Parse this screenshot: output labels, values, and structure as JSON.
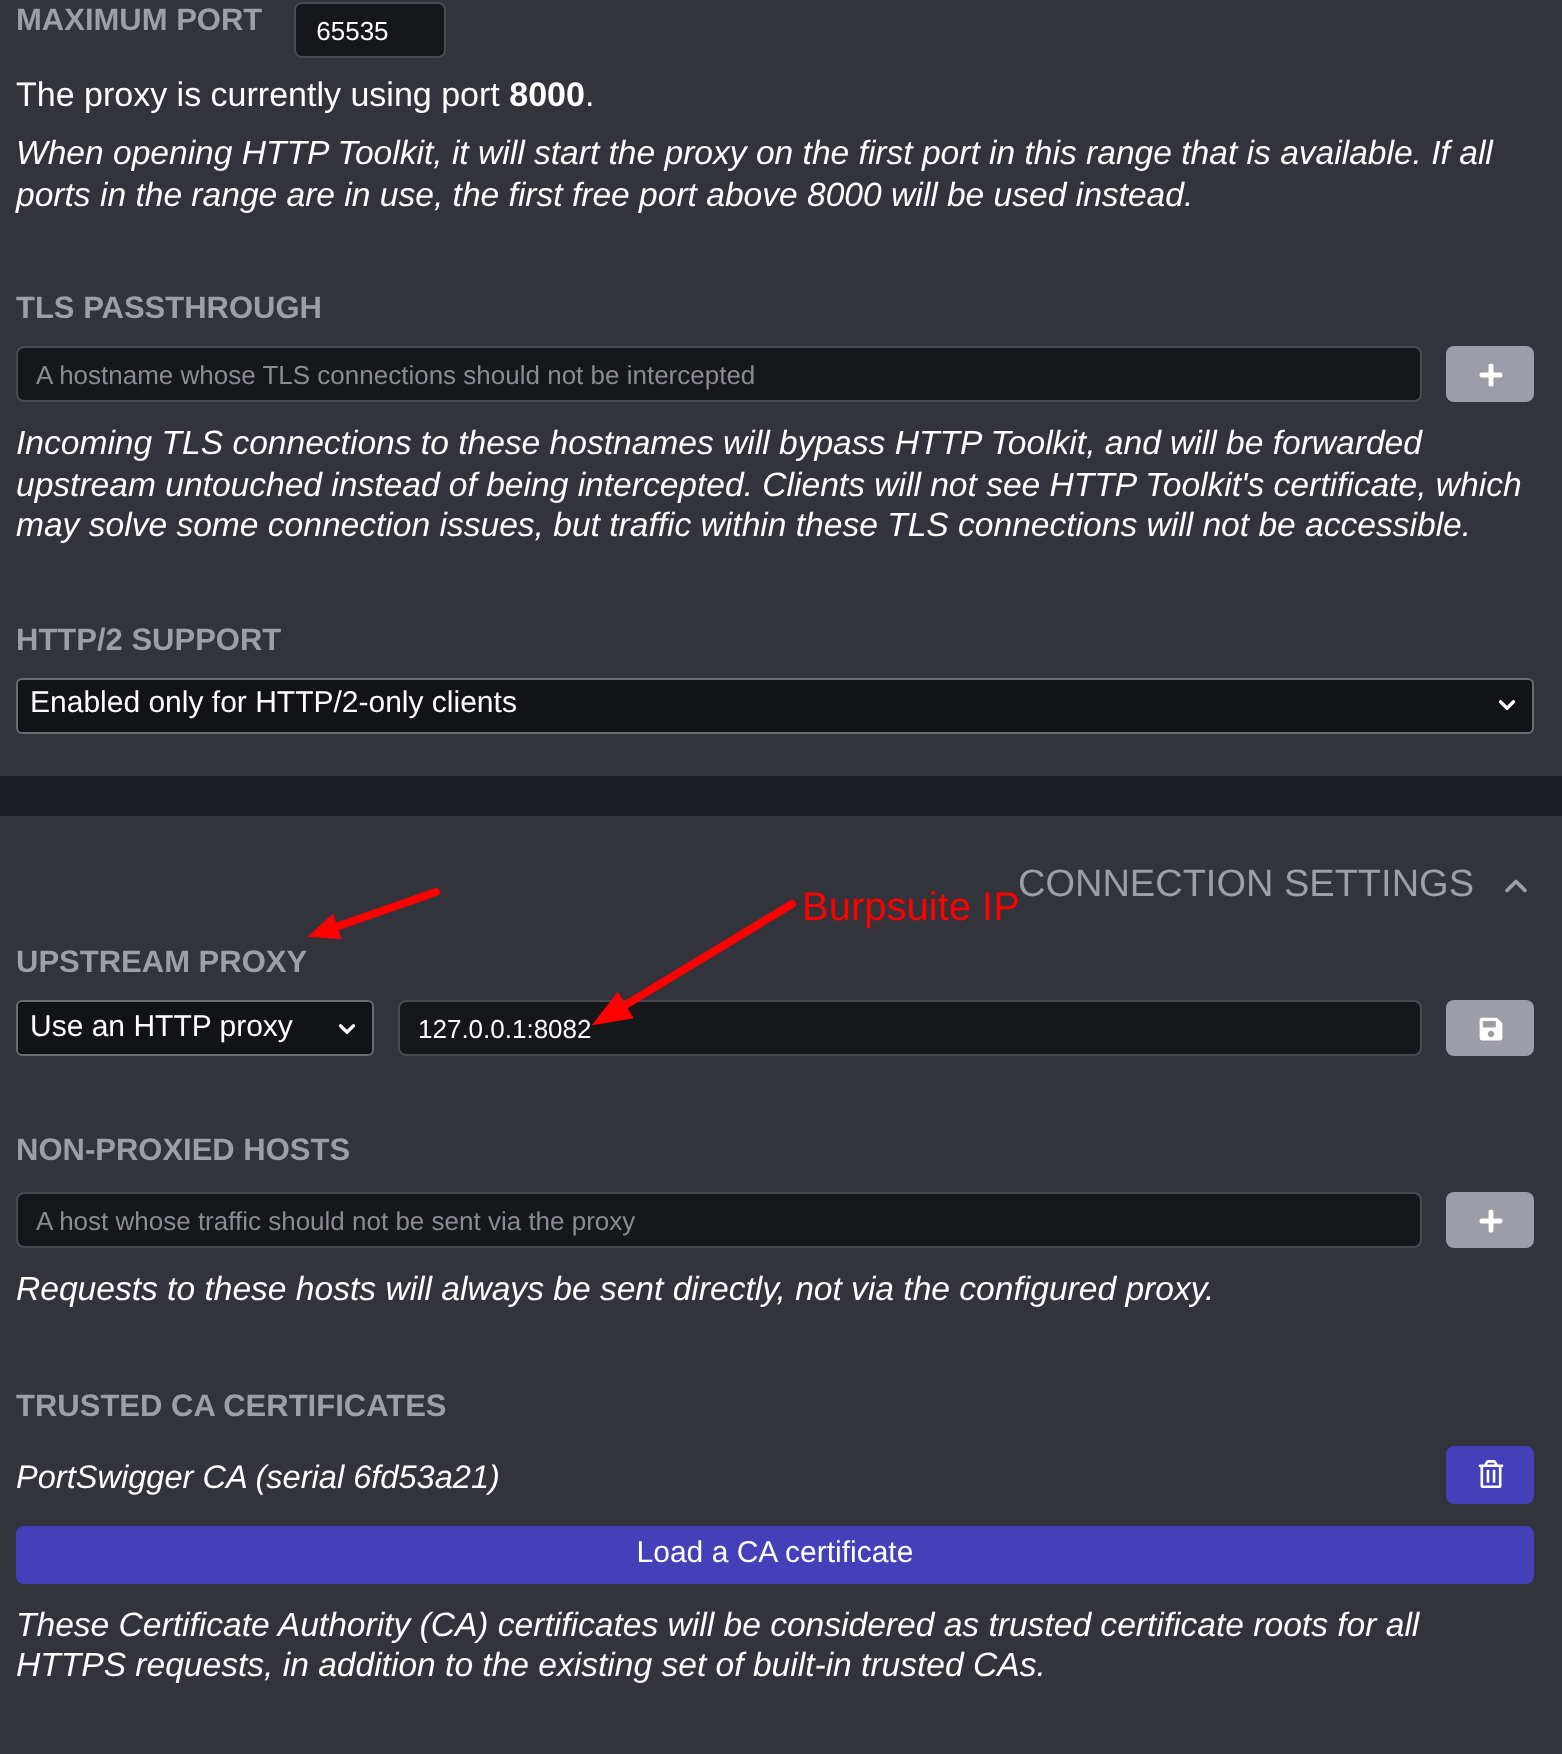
{
  "port_settings": {
    "max_port": {
      "label": "MAXIMUM PORT",
      "value": "65535"
    },
    "status": "The proxy is currently using port **8000**.",
    "note": "When opening HTTP Toolkit, it will start the proxy on the first port in this range that is available. If all ports in the range are in use, the first free port above 8000 will be used instead."
  },
  "tls_passthrough": {
    "label": "TLS PASSTHROUGH",
    "input": {
      "placeholder": "A hostname whose TLS connections should not be intercepted"
    },
    "note": "Incoming TLS connections to these hostnames will bypass HTTP Toolkit, and will be forwarded upstream untouched instead of being intercepted. Clients will not see HTTP Toolkit's certificate, which may solve some connection issues, but traffic within these TLS connections will not be accessible."
  },
  "http2_support": {
    "label": "HTTP/2 SUPPORT",
    "select": {
      "value": "Enabled only for HTTP/2-only clients"
    }
  },
  "connection_settings": {
    "title": "CONNECTION SETTINGS",
    "expanded": true,
    "upstream_proxy": {
      "label": "UPSTREAM PROXY",
      "mode": {
        "value": "Use an HTTP proxy"
      },
      "address": {
        "value": "127.0.0.1:8082"
      }
    },
    "non_proxied_hosts": {
      "label": "NON-PROXIED HOSTS",
      "input": {
        "placeholder": "A host whose traffic should not be sent via the proxy"
      },
      "note": "Requests to these hosts will always be sent directly, not via the configured proxy."
    },
    "trusted_ca_certificates": {
      "label": "TRUSTED CA CERTIFICATES",
      "certificates": [
        {
          "name": "PortSwigger CA (serial 6fd53a21)"
        }
      ],
      "load_button": "Load a CA certificate",
      "note": "These Certificate Authority (CA) certificates will be considered as trusted certificate roots for all HTTPS requests, in addition to the existing set of built-in trusted CAs."
    }
  },
  "annotation": {
    "text": "Burpsuite IP"
  }
}
